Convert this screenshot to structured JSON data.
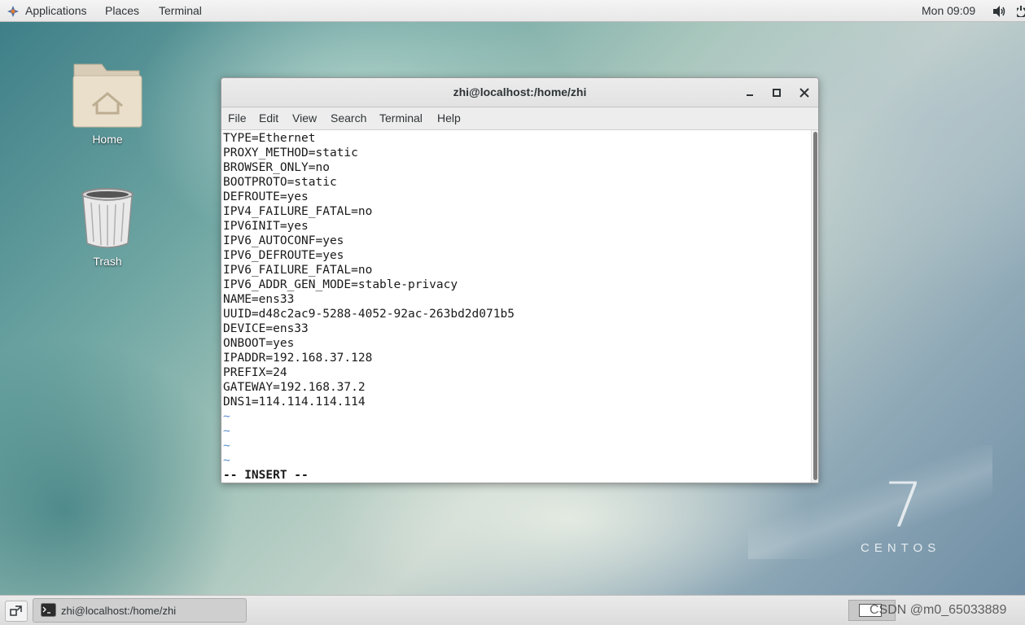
{
  "topbar": {
    "applications": "Applications",
    "places": "Places",
    "terminal": "Terminal",
    "clock": "Mon 09:09"
  },
  "desktop": {
    "home_label": "Home",
    "trash_label": "Trash",
    "logo_number": "7",
    "logo_text": "CENTOS"
  },
  "window": {
    "title": "zhi@localhost:/home/zhi",
    "menu": [
      "File",
      "Edit",
      "View",
      "Search",
      "Terminal",
      "Help"
    ]
  },
  "terminal": {
    "lines": [
      "TYPE=Ethernet",
      "PROXY_METHOD=static",
      "BROWSER_ONLY=no",
      "BOOTPROTO=static",
      "DEFROUTE=yes",
      "IPV4_FAILURE_FATAL=no",
      "IPV6INIT=yes",
      "IPV6_AUTOCONF=yes",
      "IPV6_DEFROUTE=yes",
      "IPV6_FAILURE_FATAL=no",
      "IPV6_ADDR_GEN_MODE=stable-privacy",
      "NAME=ens33",
      "UUID=d48c2ac9-5288-4052-92ac-263bd2d071b5",
      "DEVICE=ens33",
      "ONBOOT=yes",
      "IPADDR=192.168.37.128",
      "PREFIX=24",
      "GATEWAY=192.168.37.2",
      "DNS1=114.114.114.114"
    ],
    "tildes": [
      "~",
      "~",
      "~",
      "~"
    ],
    "mode": "-- INSERT --"
  },
  "taskbar": {
    "task_label": "zhi@localhost:/home/zhi",
    "watermark": "CSDN @m0_65033889"
  },
  "colors": {
    "tilde": "#5a8fd0",
    "terminal_bg": "#ffffff",
    "topbar_bg": "#f0f0f0"
  }
}
